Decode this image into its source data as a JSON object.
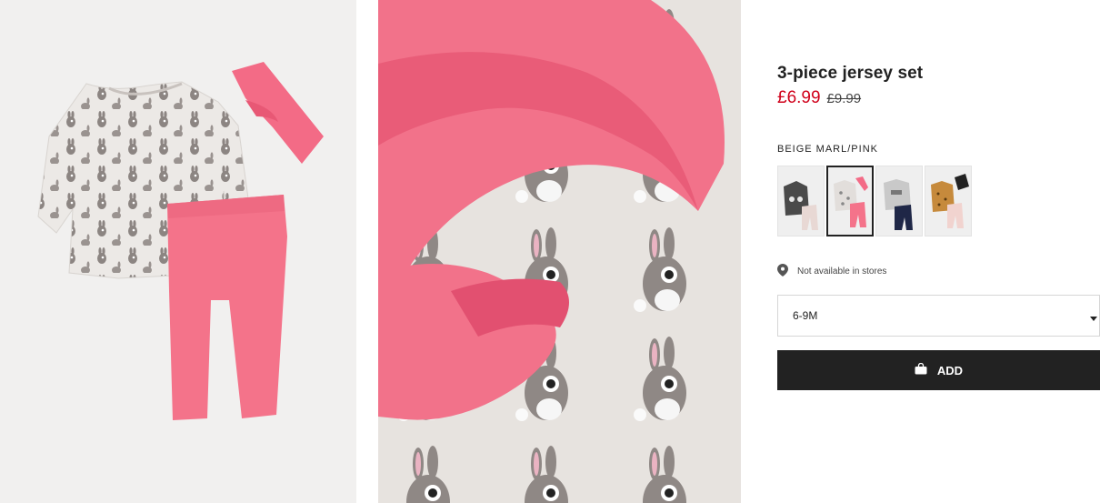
{
  "product": {
    "title": "3-piece jersey set",
    "price_current": "£6.99",
    "price_original": "£9.99"
  },
  "color": {
    "selected_label": "BEIGE MARL/PINK",
    "swatches": [
      {
        "name": "dark-grey-set",
        "selected": false
      },
      {
        "name": "beige-marl-pink-set",
        "selected": true
      },
      {
        "name": "grey-navy-set",
        "selected": false
      },
      {
        "name": "mustard-pink-set",
        "selected": false
      }
    ]
  },
  "availability": {
    "store_text": "Not available in stores",
    "icon": "location-pin-icon"
  },
  "size": {
    "selected": "6-9M",
    "icon": "caret-down-icon"
  },
  "cart": {
    "add_label": "ADD",
    "icon": "shopping-bag-icon"
  },
  "colors": {
    "sale_price": "#d0021b",
    "button_bg": "#222222",
    "legging_pink": "#f4738a"
  }
}
